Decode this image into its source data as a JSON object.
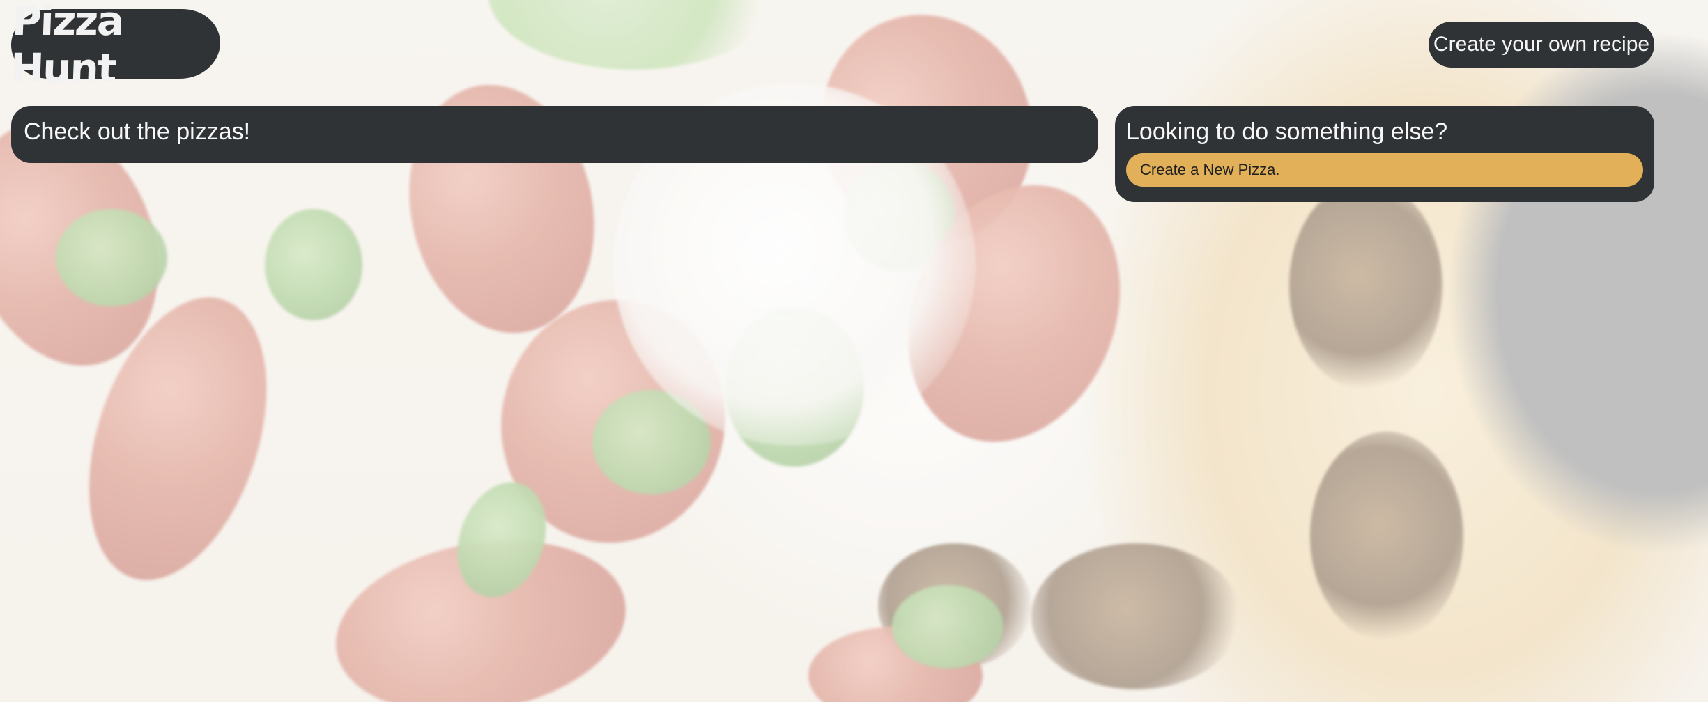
{
  "header": {
    "logo_text": "Pizza Hunt",
    "create_recipe_label": "Create your own recipe"
  },
  "main": {
    "pizzas_title": "Check out the pizzas!"
  },
  "sidebar": {
    "title": "Looking to do something else?",
    "create_pizza_label": "Create a New Pizza."
  },
  "colors": {
    "panel": "#2f3336",
    "accent": "#e3b05a",
    "text_light": "#f7f7f7"
  }
}
